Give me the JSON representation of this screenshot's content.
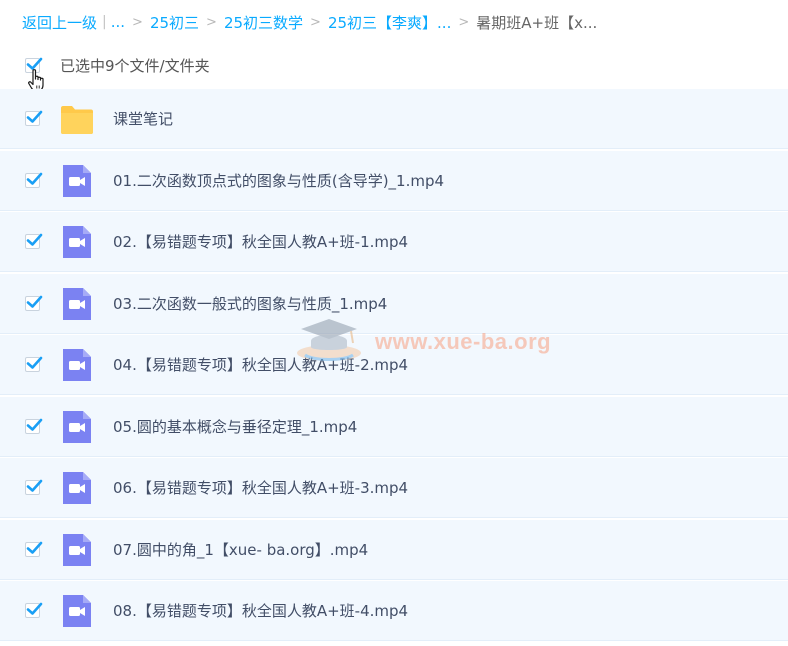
{
  "breadcrumb": {
    "back": "返回上一级",
    "pipe": "|",
    "ellipsis": "...",
    "items": [
      "25初三",
      "25初三数学",
      "25初三【李爽】..."
    ],
    "current": "暑期班A+班【x...",
    "separator": ">"
  },
  "selection": {
    "text": "已选中9个文件/文件夹",
    "checked": true
  },
  "files": [
    {
      "name": "课堂笔记",
      "type": "folder"
    },
    {
      "name": "01.二次函数顶点式的图象与性质(含导学)_1.mp4",
      "type": "video"
    },
    {
      "name": "02.【易错题专项】秋全国人教A+班-1.mp4",
      "type": "video"
    },
    {
      "name": "03.二次函数一般式的图象与性质_1.mp4",
      "type": "video"
    },
    {
      "name": "04.【易错题专项】秋全国人教A+班-2.mp4",
      "type": "video"
    },
    {
      "name": "05.圆的基本概念与垂径定理_1.mp4",
      "type": "video"
    },
    {
      "name": "06.【易错题专项】秋全国人教A+班-3.mp4",
      "type": "video"
    },
    {
      "name": "07.圆中的角_1【xue- ba.org】.mp4",
      "type": "video"
    },
    {
      "name": "08.【易错题专项】秋全国人教A+班-4.mp4",
      "type": "video"
    }
  ],
  "watermark": {
    "text": "www.xue-ba.org"
  },
  "colors": {
    "accent": "#09aaff",
    "row_background": "#f2f8fe",
    "video_icon": "#7b82f2",
    "folder_icon": "#ffc94a",
    "checkmark": "#1a9ff5"
  }
}
